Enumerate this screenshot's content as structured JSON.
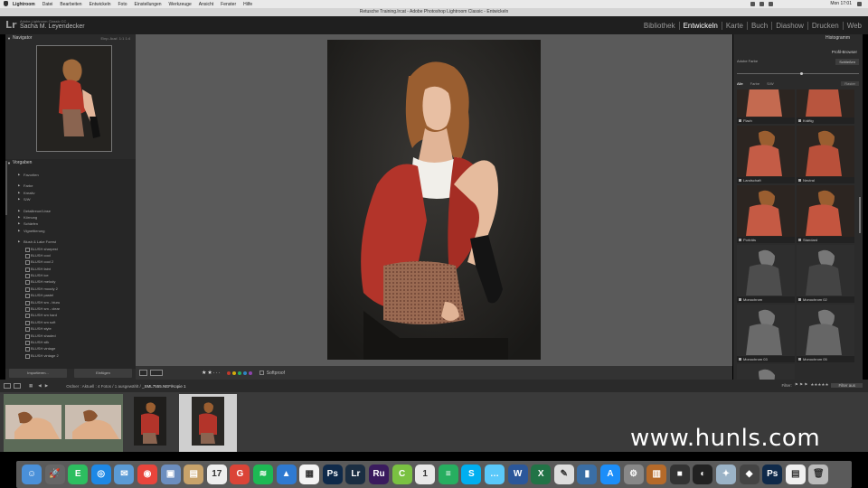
{
  "menubar": {
    "items": [
      "Lightroom",
      "Datei",
      "Bearbeiten",
      "Entwickeln",
      "Foto",
      "Einstellungen",
      "Werkzeuge",
      "Ansicht",
      "Fenster",
      "Hilfe"
    ],
    "clock": "Mon 17:01"
  },
  "window": {
    "title": "Retusche Training.lrcat - Adobe Photoshop Lightroom Classic - Entwickeln"
  },
  "identity": {
    "logo": "Lr",
    "product": "Adobe Lightroom Classic CC",
    "user": "Sacha M. Leyendecker"
  },
  "modules": [
    "Bibliothek",
    "Entwickeln",
    "Karte",
    "Buch",
    "Diashow",
    "Drucken",
    "Web"
  ],
  "modules_active": "Entwickeln",
  "navigator": {
    "title": "Navigator",
    "options": "Einp.   Ausf.   1:1   1:4"
  },
  "presets": {
    "title": "Vorgaben",
    "groups": [
      {
        "name": "Favoriten"
      },
      {
        "name": "Farbe"
      },
      {
        "name": "Kreativ"
      },
      {
        "name": "S/W"
      },
      {
        "name": "Detailtreue/Linse"
      },
      {
        "name": "Körnung"
      },
      {
        "name": "Schärfen"
      },
      {
        "name": "Vignettierung"
      }
    ],
    "open_group": "Blush & Lake Forest",
    "items": [
      "BLUSH sharpest",
      "BLUSH cool",
      "BLUSH cool 2",
      "BLUSH faint",
      "BLUSH ice",
      "BLUSH melody",
      "BLUSH moody 2",
      "BLUSH pastel",
      "BLUSH sm - bluru",
      "BLUSH sm - clear",
      "BLUSH sm hard",
      "BLUSH sm soft",
      "BLUSH style",
      "BLUSH shaded",
      "BLUSH silk",
      "BLUSH vintage",
      "BLUSH vintage 2"
    ],
    "import_button": "Importieren...",
    "export_button": "Einfügen"
  },
  "toolbar": {
    "label": "Softproof",
    "stars": 2,
    "colors": [
      "#c0392b",
      "#d4ac0d",
      "#27ae60",
      "#2e86c1",
      "#8e44ad"
    ]
  },
  "right_panel": {
    "histogram": "Histogramm",
    "profile_browser": "Profil-Browser",
    "profile_label": "Adobe Farbe",
    "close_button": "Schließen",
    "tabs": [
      "Alle",
      "Farbe",
      "S/W"
    ],
    "active_tab": "Alle",
    "reset": "Raster",
    "tiles": [
      "Flach",
      "Kräftig",
      "Landschaft",
      "Neutral",
      "Porträts",
      "Standard",
      "Monochrom",
      "Monochrom 02",
      "Monochrom 03",
      "Monochrom 05",
      ""
    ]
  },
  "filmstrip_bar": {
    "prefix": "Ordner : Aktuell : 4 Fotos / 1 ausgewählt /",
    "filename": "_SML7555.NEF/Kopie 1",
    "filter_label": "Filter:",
    "filter_value": "Filter aus"
  },
  "watermark": "www.hunls.com",
  "dock": [
    {
      "name": "finder",
      "bg": "#4a90d9",
      "glyph": "☺"
    },
    {
      "name": "launchpad",
      "bg": "#666",
      "glyph": "🚀"
    },
    {
      "name": "evernote",
      "bg": "#2dbe60",
      "glyph": "E"
    },
    {
      "name": "safari",
      "bg": "#1e88e5",
      "glyph": "◎"
    },
    {
      "name": "mail",
      "bg": "#5b9bd5",
      "glyph": "✉"
    },
    {
      "name": "chrome",
      "bg": "#e8453c",
      "glyph": "◉"
    },
    {
      "name": "preview",
      "bg": "#6c8ebf",
      "glyph": "▣"
    },
    {
      "name": "notes",
      "bg": "#c8a36b",
      "glyph": "▤"
    },
    {
      "name": "calendar",
      "bg": "#eee",
      "glyph": "17"
    },
    {
      "name": "google",
      "bg": "#db4437",
      "glyph": "G"
    },
    {
      "name": "spotify",
      "bg": "#1db954",
      "glyph": "≋"
    },
    {
      "name": "keynote",
      "bg": "#2f7ad1",
      "glyph": "▲"
    },
    {
      "name": "pages",
      "bg": "#f3f3f3",
      "glyph": "▦"
    },
    {
      "name": "photoshop",
      "bg": "#0f2a4a",
      "glyph": "Ps"
    },
    {
      "name": "lightroom",
      "bg": "#1b2e42",
      "glyph": "Lr"
    },
    {
      "name": "rush",
      "bg": "#3a1b5e",
      "glyph": "Ru"
    },
    {
      "name": "c-app",
      "bg": "#7ac142",
      "glyph": "C"
    },
    {
      "name": "onepass",
      "bg": "#e8e8e8",
      "glyph": "1"
    },
    {
      "name": "numbers",
      "bg": "#27ae60",
      "glyph": "≡"
    },
    {
      "name": "skype",
      "bg": "#00aff0",
      "glyph": "S"
    },
    {
      "name": "messages",
      "bg": "#5ac8fa",
      "glyph": "…"
    },
    {
      "name": "word",
      "bg": "#2b579a",
      "glyph": "W"
    },
    {
      "name": "excel",
      "bg": "#217346",
      "glyph": "X"
    },
    {
      "name": "textedit",
      "bg": "#ddd",
      "glyph": "✎"
    },
    {
      "name": "charts",
      "bg": "#3a6ea5",
      "glyph": "▮"
    },
    {
      "name": "appstore",
      "bg": "#1c8ef9",
      "glyph": "A"
    },
    {
      "name": "settings",
      "bg": "#888",
      "glyph": "⚙"
    },
    {
      "name": "books",
      "bg": "#b56a2a",
      "glyph": "▥"
    },
    {
      "name": "camera",
      "bg": "#333",
      "glyph": "■"
    },
    {
      "name": "screen",
      "bg": "#222",
      "glyph": "◐"
    },
    {
      "name": "compass",
      "bg": "#9bb3c7",
      "glyph": "✦"
    },
    {
      "name": "photobooth",
      "bg": "#444",
      "glyph": "◆"
    },
    {
      "name": "photoshop-2",
      "bg": "#0f2a4a",
      "glyph": "Ps"
    },
    {
      "name": "document",
      "bg": "#f0f0f0",
      "glyph": "▤"
    },
    {
      "name": "trash",
      "bg": "#bbb",
      "glyph": "🗑"
    }
  ]
}
